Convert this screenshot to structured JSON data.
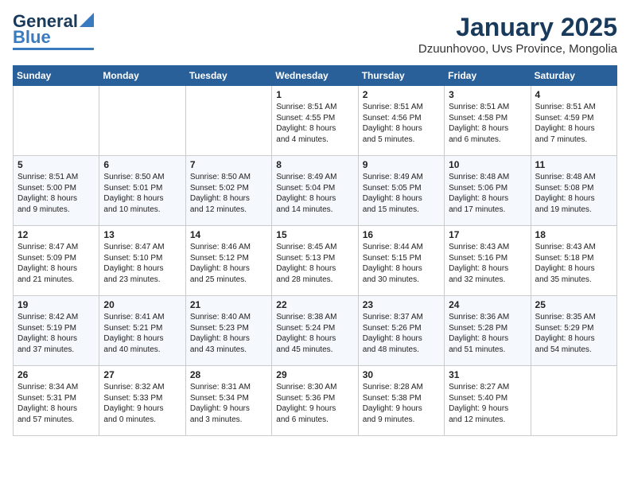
{
  "logo": {
    "line1": "General",
    "line2": "Blue"
  },
  "header": {
    "month": "January 2025",
    "location": "Dzuunhovoo, Uvs Province, Mongolia"
  },
  "weekdays": [
    "Sunday",
    "Monday",
    "Tuesday",
    "Wednesday",
    "Thursday",
    "Friday",
    "Saturday"
  ],
  "weeks": [
    [
      {
        "day": "",
        "content": ""
      },
      {
        "day": "",
        "content": ""
      },
      {
        "day": "",
        "content": ""
      },
      {
        "day": "1",
        "content": "Sunrise: 8:51 AM\nSunset: 4:55 PM\nDaylight: 8 hours\nand 4 minutes."
      },
      {
        "day": "2",
        "content": "Sunrise: 8:51 AM\nSunset: 4:56 PM\nDaylight: 8 hours\nand 5 minutes."
      },
      {
        "day": "3",
        "content": "Sunrise: 8:51 AM\nSunset: 4:58 PM\nDaylight: 8 hours\nand 6 minutes."
      },
      {
        "day": "4",
        "content": "Sunrise: 8:51 AM\nSunset: 4:59 PM\nDaylight: 8 hours\nand 7 minutes."
      }
    ],
    [
      {
        "day": "5",
        "content": "Sunrise: 8:51 AM\nSunset: 5:00 PM\nDaylight: 8 hours\nand 9 minutes."
      },
      {
        "day": "6",
        "content": "Sunrise: 8:50 AM\nSunset: 5:01 PM\nDaylight: 8 hours\nand 10 minutes."
      },
      {
        "day": "7",
        "content": "Sunrise: 8:50 AM\nSunset: 5:02 PM\nDaylight: 8 hours\nand 12 minutes."
      },
      {
        "day": "8",
        "content": "Sunrise: 8:49 AM\nSunset: 5:04 PM\nDaylight: 8 hours\nand 14 minutes."
      },
      {
        "day": "9",
        "content": "Sunrise: 8:49 AM\nSunset: 5:05 PM\nDaylight: 8 hours\nand 15 minutes."
      },
      {
        "day": "10",
        "content": "Sunrise: 8:48 AM\nSunset: 5:06 PM\nDaylight: 8 hours\nand 17 minutes."
      },
      {
        "day": "11",
        "content": "Sunrise: 8:48 AM\nSunset: 5:08 PM\nDaylight: 8 hours\nand 19 minutes."
      }
    ],
    [
      {
        "day": "12",
        "content": "Sunrise: 8:47 AM\nSunset: 5:09 PM\nDaylight: 8 hours\nand 21 minutes."
      },
      {
        "day": "13",
        "content": "Sunrise: 8:47 AM\nSunset: 5:10 PM\nDaylight: 8 hours\nand 23 minutes."
      },
      {
        "day": "14",
        "content": "Sunrise: 8:46 AM\nSunset: 5:12 PM\nDaylight: 8 hours\nand 25 minutes."
      },
      {
        "day": "15",
        "content": "Sunrise: 8:45 AM\nSunset: 5:13 PM\nDaylight: 8 hours\nand 28 minutes."
      },
      {
        "day": "16",
        "content": "Sunrise: 8:44 AM\nSunset: 5:15 PM\nDaylight: 8 hours\nand 30 minutes."
      },
      {
        "day": "17",
        "content": "Sunrise: 8:43 AM\nSunset: 5:16 PM\nDaylight: 8 hours\nand 32 minutes."
      },
      {
        "day": "18",
        "content": "Sunrise: 8:43 AM\nSunset: 5:18 PM\nDaylight: 8 hours\nand 35 minutes."
      }
    ],
    [
      {
        "day": "19",
        "content": "Sunrise: 8:42 AM\nSunset: 5:19 PM\nDaylight: 8 hours\nand 37 minutes."
      },
      {
        "day": "20",
        "content": "Sunrise: 8:41 AM\nSunset: 5:21 PM\nDaylight: 8 hours\nand 40 minutes."
      },
      {
        "day": "21",
        "content": "Sunrise: 8:40 AM\nSunset: 5:23 PM\nDaylight: 8 hours\nand 43 minutes."
      },
      {
        "day": "22",
        "content": "Sunrise: 8:38 AM\nSunset: 5:24 PM\nDaylight: 8 hours\nand 45 minutes."
      },
      {
        "day": "23",
        "content": "Sunrise: 8:37 AM\nSunset: 5:26 PM\nDaylight: 8 hours\nand 48 minutes."
      },
      {
        "day": "24",
        "content": "Sunrise: 8:36 AM\nSunset: 5:28 PM\nDaylight: 8 hours\nand 51 minutes."
      },
      {
        "day": "25",
        "content": "Sunrise: 8:35 AM\nSunset: 5:29 PM\nDaylight: 8 hours\nand 54 minutes."
      }
    ],
    [
      {
        "day": "26",
        "content": "Sunrise: 8:34 AM\nSunset: 5:31 PM\nDaylight: 8 hours\nand 57 minutes."
      },
      {
        "day": "27",
        "content": "Sunrise: 8:32 AM\nSunset: 5:33 PM\nDaylight: 9 hours\nand 0 minutes."
      },
      {
        "day": "28",
        "content": "Sunrise: 8:31 AM\nSunset: 5:34 PM\nDaylight: 9 hours\nand 3 minutes."
      },
      {
        "day": "29",
        "content": "Sunrise: 8:30 AM\nSunset: 5:36 PM\nDaylight: 9 hours\nand 6 minutes."
      },
      {
        "day": "30",
        "content": "Sunrise: 8:28 AM\nSunset: 5:38 PM\nDaylight: 9 hours\nand 9 minutes."
      },
      {
        "day": "31",
        "content": "Sunrise: 8:27 AM\nSunset: 5:40 PM\nDaylight: 9 hours\nand 12 minutes."
      },
      {
        "day": "",
        "content": ""
      }
    ]
  ]
}
